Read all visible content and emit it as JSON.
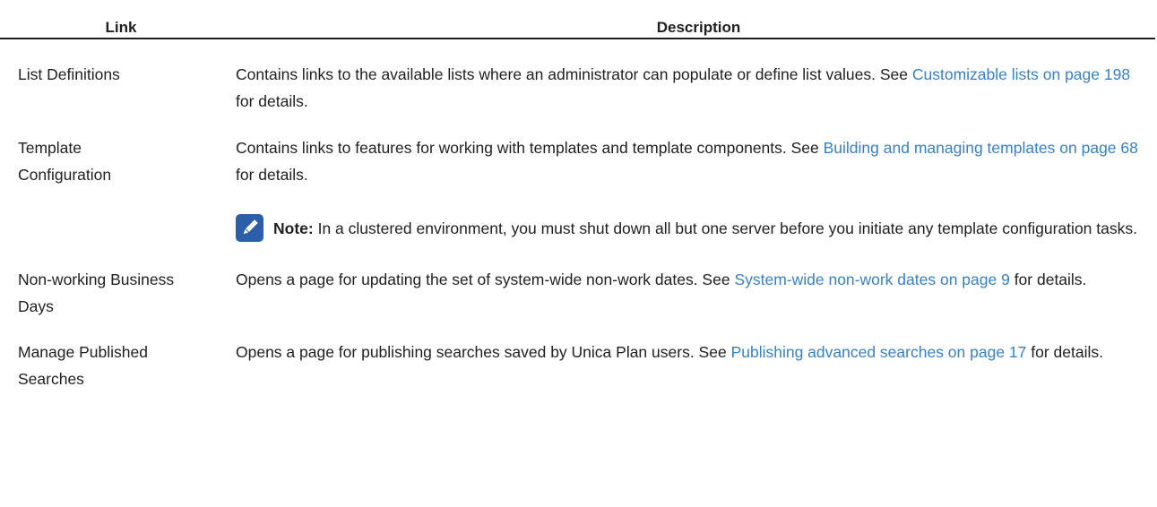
{
  "table": {
    "headers": {
      "link": "Link",
      "description": "Description"
    },
    "rows": [
      {
        "link": "List Definitions",
        "desc_before": "Contains links to the available lists where an administrator can populate or define list values. See ",
        "xref": "Customizable lists on page 198",
        "desc_after": " for details."
      },
      {
        "link_line1": "Template",
        "link_line2": "Configuration",
        "desc_before": "Contains links to features for working with templates and template components. See ",
        "xref": "Building and managing templates on page 68",
        "desc_after": " for details.",
        "note": {
          "icon": "pencil-icon",
          "label": "Note:",
          "text": " In a clustered environment, you must shut down all but one server before you initiate any template configuration tasks."
        }
      },
      {
        "link_line1": "Non-working Business",
        "link_line2": "Days",
        "desc_before": "Opens a page for updating the set of system-wide non-work dates. See ",
        "xref": "System-wide non-work dates on page 9",
        "desc_after": " for details."
      },
      {
        "link_line1": "Manage Published",
        "link_line2": "Searches",
        "desc_before": "Opens a page for publishing searches saved by Unica Plan users. See ",
        "xref": "Publishing advanced searches on page 17",
        "desc_after": " for details."
      }
    ]
  },
  "colors": {
    "xref": "#3a80c4",
    "note_icon_bg": "#2d5fa8",
    "text": "#1f1f1f"
  }
}
